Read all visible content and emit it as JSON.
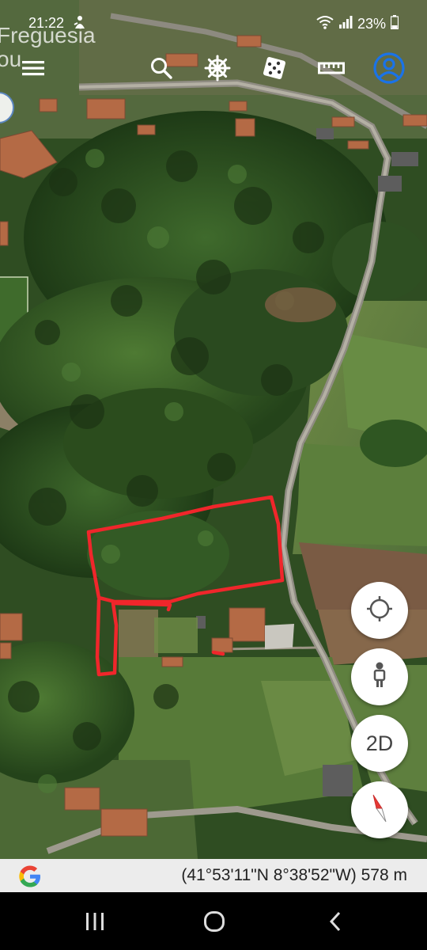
{
  "status_bar": {
    "time": "21:22",
    "battery": "23%"
  },
  "map": {
    "place_label_lines": [
      "Freguesia",
      "ou"
    ],
    "annotation_color": "#f0262b"
  },
  "toolbar": {
    "icons": [
      "menu-icon",
      "search-icon",
      "voyager-wheel-icon",
      "feeling-lucky-dice-icon",
      "measure-ruler-icon",
      "account-icon"
    ],
    "accent_color": "#1a73e8"
  },
  "map_controls": {
    "view_toggle_label": "2D",
    "icons": [
      "my-location-icon",
      "street-view-pegman-icon",
      "compass-icon"
    ]
  },
  "coordinate_bar": {
    "coordinates": "(41°53'11\"N 8°38'52\"W) 578 m"
  },
  "nav_bar": {
    "icons": [
      "recent-apps-icon",
      "home-icon",
      "back-icon"
    ]
  }
}
